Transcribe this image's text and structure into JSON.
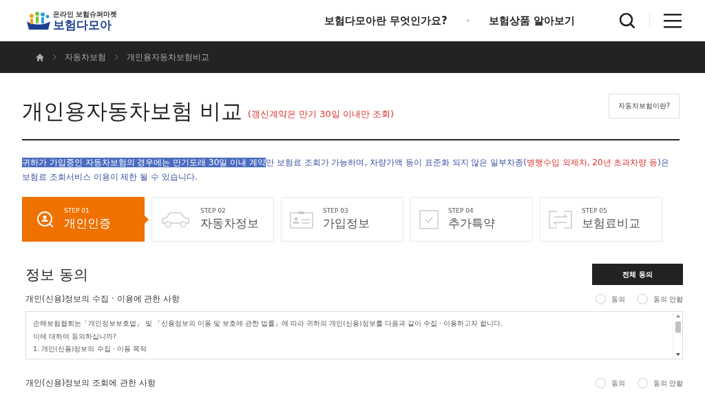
{
  "header": {
    "logo": {
      "tagline": "온라인 보험슈퍼마켓",
      "name": "보험다모아"
    },
    "nav": [
      "보험다모아란 무엇인가요?",
      "보험상품 알아보기"
    ]
  },
  "breadcrumb": [
    "자동차보험",
    "개인용자동차보험비교"
  ],
  "page": {
    "title": "개인용자동차보험 비교",
    "note": "(갱신계약은 만기 30일 이내만 조회)",
    "help_button": "자동차보험이란?"
  },
  "notice": [
    {
      "text": "귀하가 가입중인 자동차보험의 경우에는 만기도래 30일 이내 계약",
      "kind": "selected"
    },
    {
      "text": "만 보험료 조회가 가능하며, 차량가액 등이 표준화 되지 않은 일부차종(",
      "kind": "normal"
    },
    {
      "text": "병행수입 외제차, 20년 초과차량 등",
      "kind": "warning"
    },
    {
      "text": ")은 보험료 조회서비스 이용이 제한 될 수 있습니다.",
      "kind": "normal"
    }
  ],
  "steps": [
    {
      "number": "STEP 01",
      "label": "개인인증",
      "kind": "search-person",
      "selected": true
    },
    {
      "number": "STEP 02",
      "label": "자동차정보",
      "kind": "car",
      "selected": false
    },
    {
      "number": "STEP 03",
      "label": "가입정보",
      "kind": "id-card",
      "selected": false
    },
    {
      "number": "STEP 04",
      "label": "추가특약",
      "kind": "check",
      "selected": false
    },
    {
      "number": "STEP 05",
      "label": "보험료비교",
      "kind": "exchange",
      "selected": false
    }
  ],
  "consent": {
    "title": "정보 동의",
    "agree_all_button": "전체 동의",
    "items": [
      {
        "title": "개인(신용)정보의 수집 · 이용에 관한 사항",
        "options": [
          {
            "label": "동의",
            "selected": false
          },
          {
            "label": "동의 안함",
            "selected": false
          }
        ],
        "text": [
          "손해보험협회는「개인정보보호법」 및 「신용정보의 이용 및 보호에 관한 법률」에 따라 귀하의 개인(신용)정보를 다음과 같이 수집 · 이용하고자 합니다.",
          "이에 대하여 동의하십니까?",
          "1. 개인(신용)정보의 수집 · 이용 목적"
        ]
      },
      {
        "title": "개인(신용)정보의 조회에 관한 사항",
        "options": [
          {
            "label": "동의",
            "selected": false
          },
          {
            "label": "동의 안함",
            "selected": false
          }
        ]
      }
    ]
  }
}
